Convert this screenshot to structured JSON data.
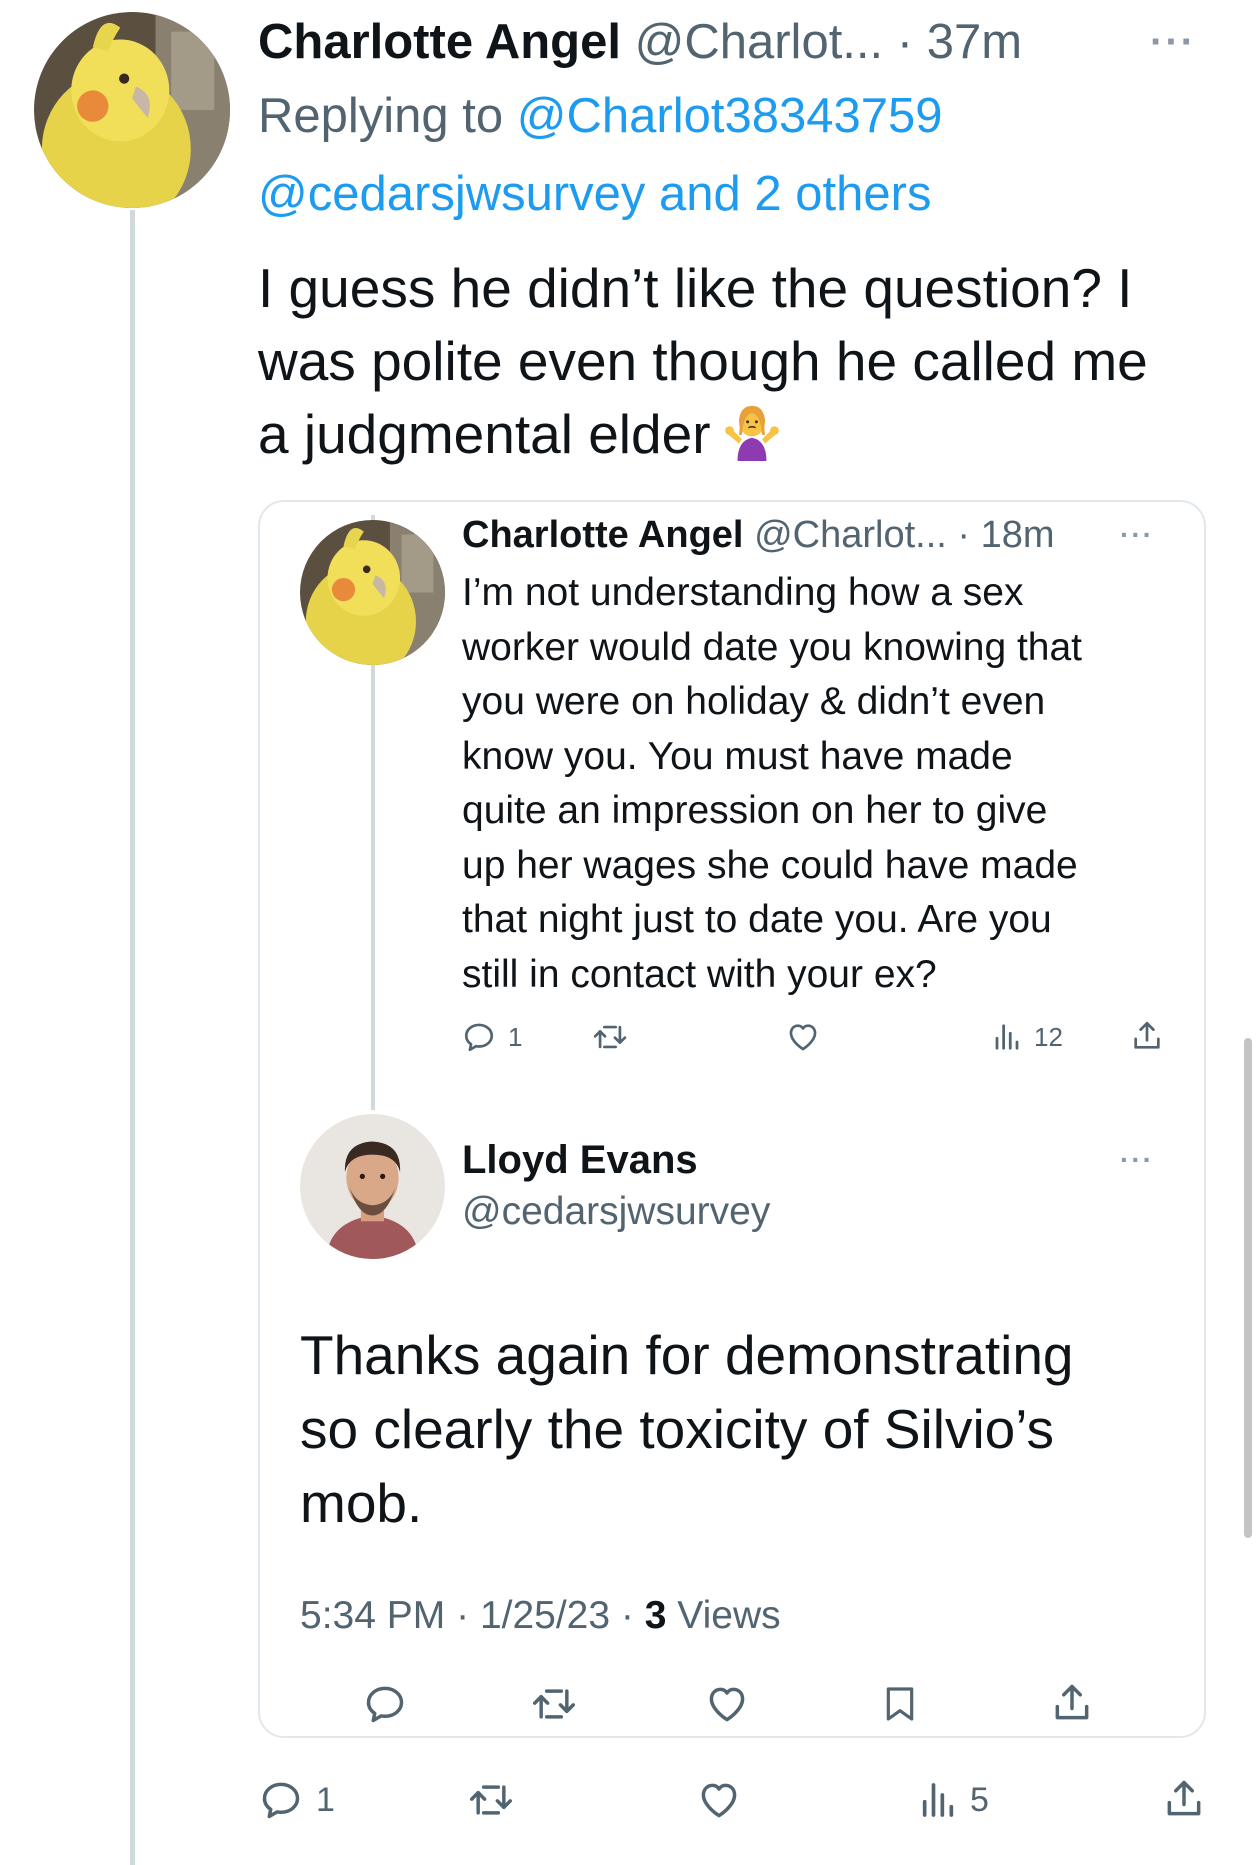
{
  "outer_tweet": {
    "author_name": "Charlotte Angel",
    "author_handle": "@Charlot...",
    "separator": "·",
    "timestamp": "37m",
    "more_label": "···",
    "replying_prefix": "Replying to",
    "replying_mention_1": "@Charlot38343759",
    "replying_mention_2": "@cedarsjwsurvey and 2 others",
    "text_lines": [
      "I guess he didn’t like the question?  I",
      "was polite even though he called me",
      "a judgmental elder"
    ],
    "emoji": "person-shrugging",
    "actions": {
      "reply_count": "1",
      "retweet_count": "",
      "like_count": "",
      "views_count": "5"
    }
  },
  "quoted_thread": {
    "first_tweet": {
      "author_name": "Charlotte Angel",
      "author_handle": "@Charlot...",
      "separator": "·",
      "timestamp": "18m",
      "more_label": "···",
      "text_lines": [
        "I’m not understanding how a sex",
        "worker would date you knowing that",
        "you were on holiday & didn’t even",
        "know you. You must have made",
        "quite an impression on her to give",
        "up her wages she could have made",
        "that night just to date you. Are you",
        "still in contact with your ex?"
      ],
      "actions": {
        "reply_count": "1",
        "views_count": "12"
      }
    },
    "main_tweet": {
      "author_name": "Lloyd Evans",
      "author_handle": "@cedarsjwsurvey",
      "more_label": "···",
      "text_lines": [
        "Thanks again for demonstrating",
        "so clearly the toxicity of Silvio’s",
        "mob."
      ],
      "time": "5:34 PM",
      "separator": "·",
      "date": "1/25/23",
      "views_count": "3",
      "views_label": "Views"
    }
  },
  "icons": [
    "reply-icon",
    "retweet-icon",
    "like-icon",
    "views-icon",
    "share-icon",
    "bookmark-icon"
  ],
  "colors": {
    "text_primary": "#0f1419",
    "text_secondary": "#536471",
    "link": "#1d9bf0",
    "thread_line": "#cfd9de",
    "card_border": "#e1e8ed"
  }
}
